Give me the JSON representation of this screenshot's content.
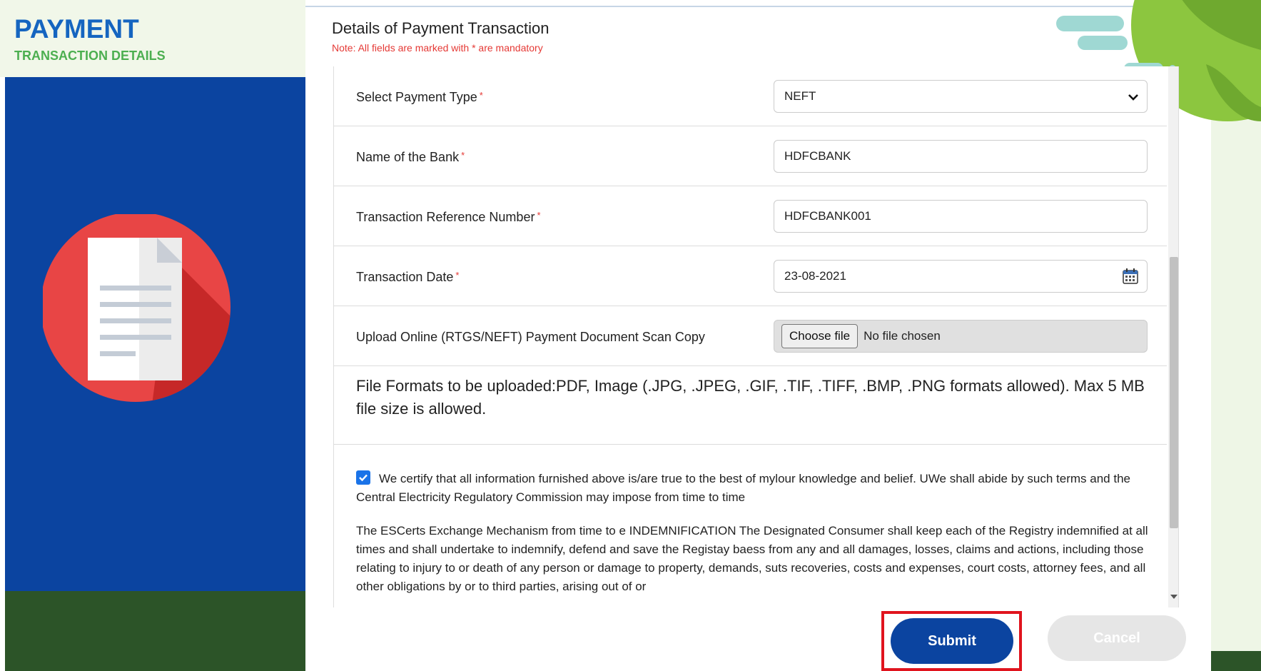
{
  "sidebar": {
    "title": "PAYMENT",
    "subtitle": "TRANSACTION DETAILS"
  },
  "form": {
    "title": "Details of Payment Transaction",
    "note": "Note: All fields are marked with * are mandatory",
    "required_marker": "*",
    "fields": {
      "payment_type": {
        "label": "Select Payment Type",
        "value": "NEFT",
        "options": [
          "NEFT"
        ]
      },
      "bank_name": {
        "label": "Name of the Bank",
        "value": "HDFCBANK"
      },
      "reference_number": {
        "label": "Transaction Reference Number",
        "value": "HDFCBANK001"
      },
      "transaction_date": {
        "label": "Transaction Date",
        "value": "23-08-2021"
      },
      "upload": {
        "label": "Upload Online (RTGS/NEFT) Payment Document Scan Copy",
        "button_label": "Choose file",
        "status": "No file chosen"
      }
    },
    "file_formats_note": "File Formats to be uploaded:PDF, Image (.JPG, .JPEG, .GIF, .TIF, .TIFF, .BMP, .PNG formats allowed). Max 5 MB file size is allowed.",
    "certification": {
      "checked": true,
      "text": "We certify that all information furnished above is/are true to the best of mylour knowledge and belief. UWe shall abide by such terms and the Central Electricity Regulatory Commission may impose from time to time"
    },
    "indemnification_text": "The ESCerts Exchange Mechanism from time to e INDEMNIFICATION The Designated Consumer shall keep each of the Registry indemnified at all times and shall undertake to indemnify, defend and save the Registay baess from any and all damages, losses, claims and actions, including those relating to injury to or death of any person or damage to property, demands, suts recoveries, costs and expenses, court costs, attorney fees, and all other obligations by or to third parties, arising out of or"
  },
  "actions": {
    "submit_label": "Submit",
    "cancel_label": "Cancel"
  },
  "colors": {
    "brand_blue": "#0b44a0",
    "accent_green": "#4caf50",
    "required_red": "#e53935",
    "highlight_red": "#e0141e"
  }
}
